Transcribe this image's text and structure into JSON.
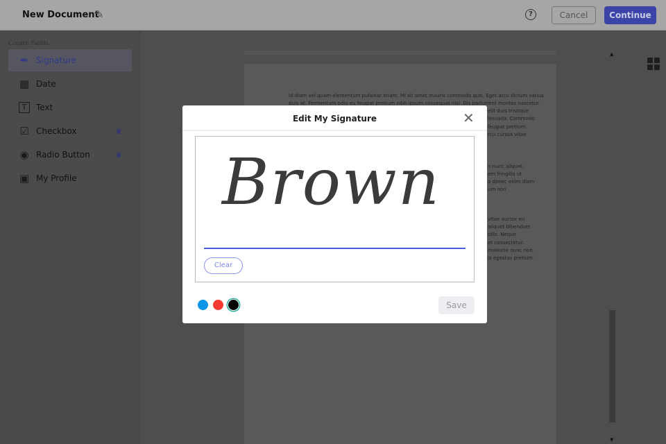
{
  "header": {
    "title": "New Document",
    "help": "?",
    "cancel": "Cancel",
    "continue": "Continue"
  },
  "sidebar": {
    "heading": "Create Fields",
    "items": [
      {
        "label": "Signature",
        "icon": "✒"
      },
      {
        "label": "Date",
        "icon": "▦"
      },
      {
        "label": "Text",
        "icon": "T"
      },
      {
        "label": "Checkbox",
        "icon": "☑"
      },
      {
        "label": "Radio Button",
        "icon": "◉"
      },
      {
        "label": "My Profile",
        "icon": "▣"
      }
    ],
    "crown": "♛"
  },
  "document": {
    "lines": [
      "Id diam vel quam elementum pulvinar etiam. Mi sit amet mauris commodo quis. Eget arcu dictum varius",
      "duis at. Fermentum odio eu feugiat pretium nibh ipsum consequat nisl. Dis parturient montes nascetur"
    ],
    "fragments": [
      "elit duis tristique",
      "lesuada. Commodo",
      "feugiat pretium",
      "rcu cursus vitae",
      "n nunc aliquet.",
      "em fringilla ut",
      "o donec enim diam",
      "um non",
      "vitae auctor eu",
      "aliquet bibendum",
      "ollis. Neque",
      "et consectetur.",
      "molestie nunc non.",
      "is egestas pretium."
    ]
  },
  "modal": {
    "title": "Edit My Signature",
    "close": "✕",
    "signature": "Brown",
    "clear": "Clear",
    "save": "Save",
    "colors": [
      "#0a96e6",
      "#f53a32",
      "#000000"
    ],
    "selected_color": "#000000"
  }
}
